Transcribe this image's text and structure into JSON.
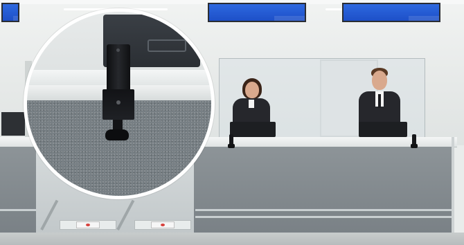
{
  "scene": {
    "description_colors": {
      "screen_blue": "#2e69e0",
      "counter_grey": "#7a8186",
      "device_black": "#17181b"
    },
    "icons": [
      "monitor-screen-icon",
      "card-reader-device-icon"
    ]
  }
}
